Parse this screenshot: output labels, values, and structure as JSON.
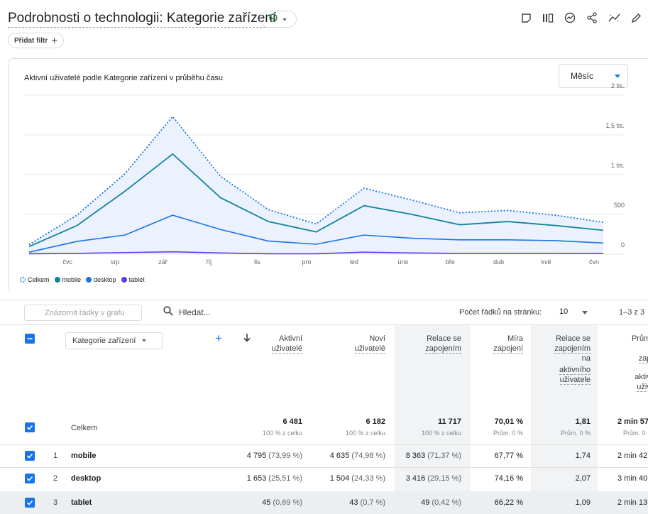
{
  "header": {
    "title": "Podrobnosti o technologii: Kategorie zařízení",
    "add_filter_label": "Přidat filtr",
    "icons": [
      "check-circle-icon",
      "chevron-down-icon",
      "bookmark-icon",
      "compare-icon",
      "insights-icon",
      "share-icon",
      "trend-icon",
      "edit-icon"
    ]
  },
  "chart": {
    "title": "Aktivní uživatelé podle Kategorie zařízení v průběhu času",
    "period_select": "Měsíc",
    "y_ticks": [
      "2 tis.",
      "1,5 tis.",
      "1 tis.",
      "500",
      "0"
    ],
    "x_ticks": [
      "čvc",
      "srp",
      "zář",
      "říj",
      "lis",
      "pro",
      "led",
      "úno",
      "bře",
      "dub",
      "kvě",
      "čvn"
    ],
    "legend": [
      "Celkem",
      "mobile",
      "desktop",
      "tablet"
    ],
    "colors": {
      "total": "#1a73e8",
      "mobile": "#12849b",
      "desktop": "#1a73e8",
      "tablet": "#5b3ee6",
      "fill": "#e8f0fe"
    }
  },
  "chart_data": {
    "type": "line",
    "x": [
      "",
      "čvc",
      "srp",
      "zář",
      "říj",
      "lis",
      "pro",
      "led",
      "úno",
      "bře",
      "dub",
      "kvě",
      "čvn"
    ],
    "ylim": [
      0,
      2000
    ],
    "series": [
      {
        "name": "Celkem",
        "values": [
          120,
          490,
          1010,
          1730,
          980,
          560,
          380,
          830,
          680,
          520,
          550,
          490,
          400
        ]
      },
      {
        "name": "mobile",
        "values": [
          95,
          360,
          790,
          1260,
          710,
          410,
          280,
          610,
          500,
          370,
          410,
          360,
          300
        ]
      },
      {
        "name": "desktop",
        "values": [
          25,
          160,
          240,
          490,
          310,
          165,
          125,
          240,
          200,
          180,
          180,
          170,
          140
        ]
      },
      {
        "name": "tablet",
        "values": [
          5,
          10,
          20,
          30,
          15,
          5,
          5,
          25,
          15,
          10,
          10,
          10,
          8
        ]
      }
    ],
    "ylabel": "",
    "xlabel": ""
  },
  "table": {
    "plot_rows_placeholder": "Znázornit řádky v grafu",
    "search_placeholder": "Hledat...",
    "rows_per_page_label": "Počet řádků na stránku:",
    "rows_per_page_value": "10",
    "pagination": "1–3 z 3",
    "dimension_label": "Kategorie zařízení",
    "columns": [
      [
        "Aktivní",
        "uživatelé"
      ],
      [
        "Noví",
        "uživatelé"
      ],
      [
        "Relace se",
        "zapojením"
      ],
      [
        "Míra",
        "zapojení"
      ],
      [
        "Relace se",
        "zapojením",
        "na",
        "aktivního",
        "uživatele"
      ],
      [
        "Průměr",
        "do",
        "zapoj",
        "aktivní",
        "uživat"
      ]
    ],
    "total_row": {
      "label": "Celkem",
      "values": [
        "6 481",
        "6 182",
        "11 717",
        "70,01 %",
        "1,81",
        "2 min 57"
      ],
      "subs": [
        "100 % z celku",
        "100 % z celku",
        "100 % z celku",
        "Prům. 0 %",
        "Prům. 0 %",
        "Prům. 0"
      ]
    },
    "rows": [
      {
        "num": "1",
        "label": "mobile",
        "values": [
          "4 795",
          "4 635",
          "8 363",
          "67,77 %",
          "1,74",
          "2 min 42"
        ],
        "pcts": [
          "(73,99 %)",
          "(74,98 %)",
          "(71,37 %)",
          "",
          "",
          ""
        ]
      },
      {
        "num": "2",
        "label": "desktop",
        "values": [
          "1 653",
          "1 504",
          "3 416",
          "74,16 %",
          "2,07",
          "3 min 40"
        ],
        "pcts": [
          "(25,51 %)",
          "(24,33 %)",
          "(29,15 %)",
          "",
          "",
          ""
        ]
      },
      {
        "num": "3",
        "label": "tablet",
        "values": [
          "45",
          "43",
          "49",
          "66,22 %",
          "1,09",
          "2 min 13"
        ],
        "pcts": [
          "(0,69 %)",
          "(0,7 %)",
          "(0,42 %)",
          "",
          "",
          ""
        ]
      }
    ]
  }
}
